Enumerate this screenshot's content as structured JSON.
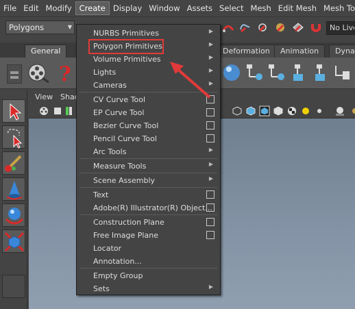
{
  "menubar": {
    "items": [
      "File",
      "Edit",
      "Modify",
      "Create",
      "Display",
      "Window",
      "Assets",
      "Select",
      "Mesh",
      "Edit Mesh",
      "Mesh Tools"
    ],
    "active": "Create"
  },
  "statusline": {
    "mode": "Polygons",
    "live_label": "No Live"
  },
  "shelf": {
    "tabs": [
      "General",
      "Deformation",
      "Animation",
      "Dynar"
    ],
    "selected_tab": "General"
  },
  "panel": {
    "menus": [
      "View",
      "Shad"
    ]
  },
  "create_menu": {
    "items": [
      {
        "label": "NURBS Primitives",
        "kind": "submenu"
      },
      {
        "label": "Polygon Primitives",
        "kind": "submenu",
        "highlighted": true
      },
      {
        "label": "Volume Primitives",
        "kind": "submenu"
      },
      {
        "label": "Lights",
        "kind": "submenu"
      },
      {
        "label": "Cameras",
        "kind": "submenu"
      },
      {
        "label": "CV Curve Tool",
        "kind": "option"
      },
      {
        "label": "EP Curve Tool",
        "kind": "option"
      },
      {
        "label": "Bezier Curve Tool",
        "kind": "option"
      },
      {
        "label": "Pencil Curve Tool",
        "kind": "option"
      },
      {
        "label": "Arc Tools",
        "kind": "submenu"
      },
      {
        "label": "Measure Tools",
        "kind": "submenu"
      },
      {
        "label": "Scene Assembly",
        "kind": "submenu"
      },
      {
        "label": "Text",
        "kind": "option"
      },
      {
        "label": "Adobe(R) Illustrator(R) Object...",
        "kind": "option"
      },
      {
        "label": "Construction Plane",
        "kind": "option"
      },
      {
        "label": "Free Image Plane",
        "kind": "option"
      },
      {
        "label": "Locator",
        "kind": "plain"
      },
      {
        "label": "Annotation...",
        "kind": "plain"
      },
      {
        "label": "Empty Group",
        "kind": "plain"
      },
      {
        "label": "Sets",
        "kind": "submenu"
      }
    ]
  },
  "colors": {
    "annotation_red": "#e23a3a",
    "ui_bg": "#444444",
    "viewport_top": "#6f7f8f"
  }
}
